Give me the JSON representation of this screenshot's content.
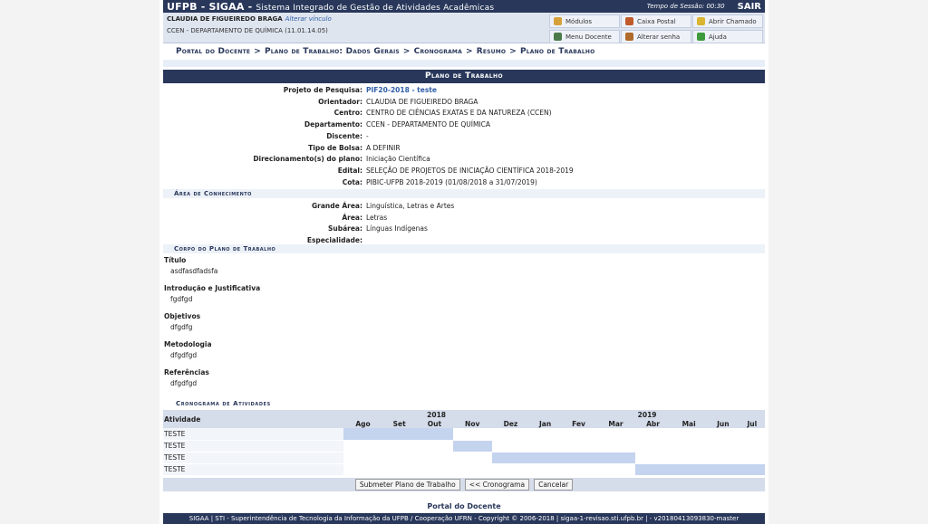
{
  "header": {
    "brand": "UFPB - SIGAA -",
    "system_name": "Sistema Integrado de Gestão de Atividades Acadêmicas",
    "session_label": "Tempo de Sessão: 00:30",
    "logout": "SAIR"
  },
  "user": {
    "name": "CLAUDIA DE FIGUEIREDO BRAGA",
    "change_link": "Alterar vínculo",
    "department": "CCEN - DEPARTAMENTO DE QUÍMICA (11.01.14.05)"
  },
  "quick_buttons": [
    {
      "label": "Módulos",
      "icon": "modules-icon",
      "color": "#d7a13a"
    },
    {
      "label": "Caixa Postal",
      "icon": "mailbox-icon",
      "color": "#c05a2a"
    },
    {
      "label": "Abrir Chamado",
      "icon": "ticket-icon",
      "color": "#d9b531"
    },
    {
      "label": "Menu Docente",
      "icon": "menu-icon",
      "color": "#4a7a4a"
    },
    {
      "label": "Alterar senha",
      "icon": "password-icon",
      "color": "#b06a2a"
    },
    {
      "label": "Ajuda",
      "icon": "help-icon",
      "color": "#3f9a3f"
    }
  ],
  "breadcrumb": [
    "Portal do Docente",
    "Plano de Trabalho: Dados Gerais",
    "Cronograma",
    "Resumo",
    "Plano de Trabalho"
  ],
  "breadcrumb_sep": ">",
  "panel_title": "Plano de Trabalho",
  "fields": [
    {
      "label": "Projeto de Pesquisa:",
      "value": "PIF20-2018 - teste",
      "link": true
    },
    {
      "label": "Orientador:",
      "value": "CLAUDIA DE FIGUEIREDO BRAGA"
    },
    {
      "label": "Centro:",
      "value": "CENTRO DE CIÊNCIAS EXATAS E DA NATUREZA (CCEN)"
    },
    {
      "label": "Departamento:",
      "value": "CCEN - DEPARTAMENTO DE QUÍMICA"
    },
    {
      "label": "Discente:",
      "value": "-"
    },
    {
      "label": "Tipo de Bolsa:",
      "value": "A DEFINIR"
    },
    {
      "label": "Direcionamento(s) do plano:",
      "value": "Iniciação Científica"
    },
    {
      "label": "Edital:",
      "value": "SELEÇÃO DE PROJETOS DE INICIAÇÃO CIENTÍFICA 2018-2019"
    },
    {
      "label": "Cota:",
      "value": "PIBIC-UFPB 2018-2019 (01/08/2018 a 31/07/2019)"
    }
  ],
  "area_section": "Área de Conhecimento",
  "area_fields": [
    {
      "label": "Grande Área:",
      "value": "Linguística, Letras e Artes"
    },
    {
      "label": "Área:",
      "value": "Letras"
    },
    {
      "label": "Subárea:",
      "value": "Línguas Indígenas"
    },
    {
      "label": "Especialidade:",
      "value": ""
    }
  ],
  "body_section": "Corpo do Plano de Trabalho",
  "body_items": [
    {
      "title": "Título",
      "value": "asdfasdfadsfa"
    },
    {
      "title": "Introdução e Justificativa",
      "value": "fgdfgd"
    },
    {
      "title": "Objetivos",
      "value": "dfgdfg"
    },
    {
      "title": "Metodologia",
      "value": "dfgdfgd"
    },
    {
      "title": "Referências",
      "value": "dfgdfgd"
    }
  ],
  "schedule": {
    "section": "Cronograma de Atividades",
    "activity_header": "Atividade",
    "years": [
      {
        "label": "2018",
        "span": 5
      },
      {
        "label": "2019",
        "span": 7
      }
    ],
    "months": [
      "Ago",
      "Set",
      "Out",
      "Nov",
      "Dez",
      "Jan",
      "Fev",
      "Mar",
      "Abr",
      "Mai",
      "Jun",
      "Jul"
    ],
    "rows": [
      {
        "activity": "TESTE",
        "active": [
          0,
          1,
          2
        ]
      },
      {
        "activity": "TESTE",
        "active": [
          3
        ]
      },
      {
        "activity": "TESTE",
        "active": [
          4,
          5,
          6,
          7
        ]
      },
      {
        "activity": "TESTE",
        "active": [
          8,
          9,
          10,
          11
        ]
      }
    ]
  },
  "actions": {
    "submit": "Submeter Plano de Trabalho",
    "back": "<< Cronograma",
    "cancel": "Cancelar"
  },
  "portal_link": "Portal do Docente",
  "footer": "SIGAA | STI - Superintendência de Tecnologia da Informação da UFPB / Cooperação UFRN - Copyright © 2006-2018 | sigaa-1-revisao.sti.ufpb.br | - v20180413093830-master",
  "colors": {
    "brand": "#28375a",
    "link": "#2f5ea8",
    "active_cell": "#c4d3ee"
  }
}
